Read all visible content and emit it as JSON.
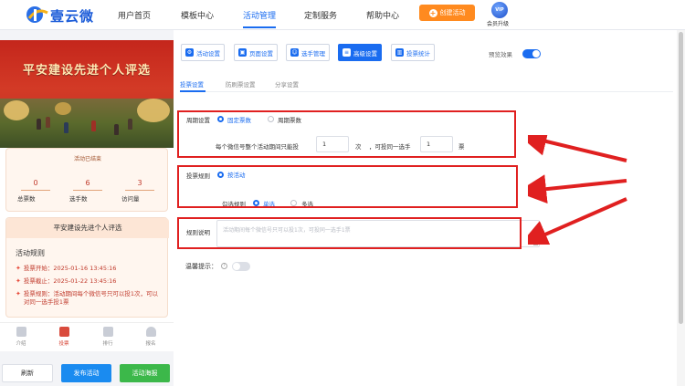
{
  "brand": {
    "name": "壹云微"
  },
  "nav": {
    "items": [
      "用户首页",
      "模板中心",
      "活动管理",
      "定制服务",
      "帮助中心"
    ],
    "create_label": "创建活动",
    "vip_badge": "VIP",
    "vip_label": "会员升级"
  },
  "preview": {
    "banner_title": "平安建设先进个人评选",
    "status_title": "活动已结束",
    "stats": [
      {
        "value": "0",
        "label": "总票数"
      },
      {
        "value": "6",
        "label": "选手数"
      },
      {
        "value": "3",
        "label": "访问量"
      }
    ],
    "rules_header": "平安建设先进个人评选",
    "rules_subtitle": "活动规则",
    "rules": [
      "投票开始：2025-01-16 13:45:16",
      "投票截止：2025-01-22 13:45:16",
      "投票规则：活动期间每个微信号只可以投1次，可以对同一选手投1票"
    ],
    "tabs": [
      "介绍",
      "投票",
      "排行",
      "报名"
    ]
  },
  "actions": {
    "refresh": "刷新",
    "publish": "发布活动",
    "poster": "活动海报"
  },
  "toolbar": {
    "buttons": [
      "活动设置",
      "页面设置",
      "选手管理",
      "高级设置",
      "投票统计"
    ],
    "preview_label": "预览效果"
  },
  "subtabs": [
    "投票设置",
    "防刷票设置",
    "分享设置"
  ],
  "form": {
    "period_label": "周期设置",
    "period_options": [
      "固定票数",
      "周期票数"
    ],
    "limit_text_1": "每个微信号整个活动期间只能投",
    "limit_value_1": "1",
    "limit_unit_1": "次",
    "limit_text_2": "，可投同一选手",
    "limit_value_2": "1",
    "limit_unit_2": "票",
    "rule_label": "投票规则",
    "rule_option": "按活动",
    "check_label": "勾选规则",
    "check_options": [
      "单选",
      "多选"
    ],
    "desc_label": "规则说明",
    "desc_placeholder": "活动期间每个微信号只可以投1次，可投同一选手1票",
    "tip_label": "温馨提示：",
    "help_glyph": "?"
  }
}
